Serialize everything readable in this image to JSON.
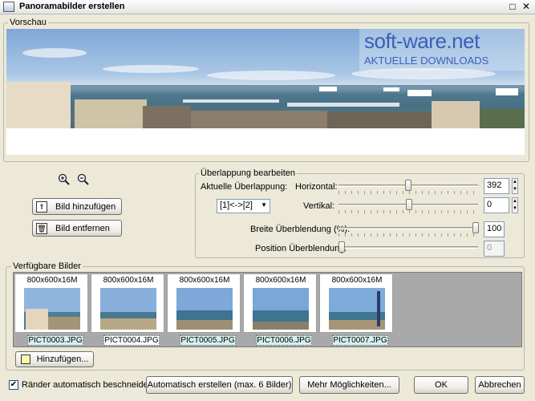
{
  "window": {
    "title": "Panoramabilder erstellen"
  },
  "preview": {
    "label": "Vorschau",
    "watermark_title": "soft-ware.net",
    "watermark_sub": "AKTUELLE DOWNLOADS"
  },
  "buttons": {
    "add_image": "Bild hinzufügen",
    "remove_image": "Bild entfernen",
    "add_more": "Hinzufügen...",
    "auto_create": "Automatisch erstellen (max. 6 Bilder)",
    "more_options": "Mehr Möglichkeiten...",
    "ok": "OK",
    "cancel": "Abbrechen"
  },
  "overlap": {
    "group_label": "Überlappung bearbeiten",
    "current_label": "Aktuelle Überlappung:",
    "current_value": "[1]<->[2]",
    "horizontal_label": "Horizontal:",
    "horizontal_value": "392",
    "vertical_label": "Vertikal:",
    "vertical_value": "0",
    "blend_width_label": "Breite Überblendung (%):",
    "blend_width_value": "100",
    "blend_position_label": "Position Überblendung:",
    "blend_position_value": "0"
  },
  "available": {
    "label": "Verfügbare Bilder",
    "items": [
      {
        "dims": "800x600x16M",
        "name": "PICT0003.JPG"
      },
      {
        "dims": "800x600x16M",
        "name": "PICT0004.JPG"
      },
      {
        "dims": "800x600x16M",
        "name": "PICT0005.JPG"
      },
      {
        "dims": "800x600x16M",
        "name": "PICT0006.JPG"
      },
      {
        "dims": "800x600x16M",
        "name": "PICT0007.JPG"
      }
    ]
  },
  "options": {
    "auto_crop_label": "Ränder automatisch beschneiden",
    "auto_crop_checked": true
  },
  "colors": {
    "background": "#ece9d8",
    "watermark": "#3a5fb8",
    "thumb_label_bg": "#d7f0ef"
  }
}
